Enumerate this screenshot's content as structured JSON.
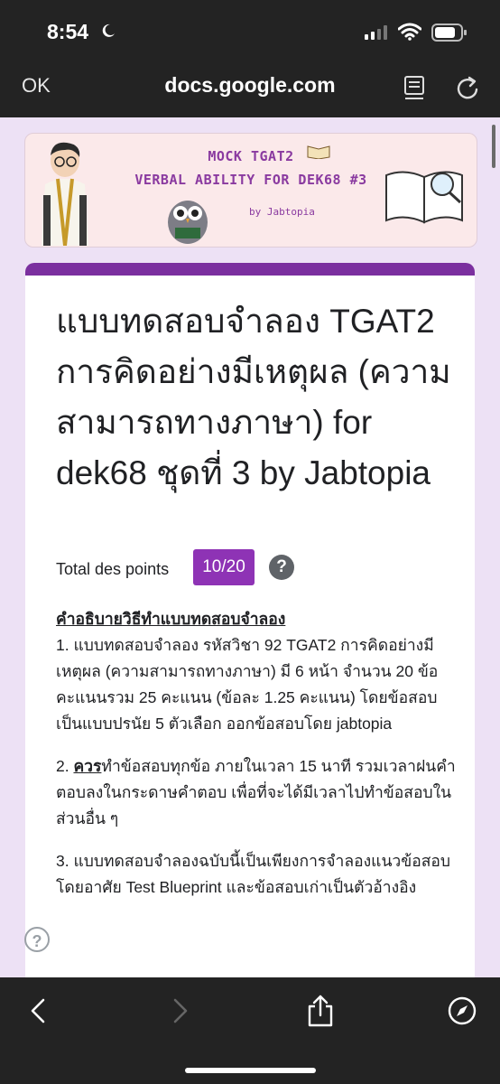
{
  "status": {
    "time": "8:54"
  },
  "browser": {
    "ok_label": "OK",
    "url": "docs.google.com"
  },
  "banner": {
    "line1": "MOCK TGAT2",
    "line2": "VERBAL ABILITY FOR DEK68 #3",
    "by": "by Jabtopia"
  },
  "form": {
    "title": "แบบทดสอบจำลอง TGAT2 การคิดอย่างมีเหตุผล (ความสามารถทางภาษา) for dek68 ชุดที่ 3 by Jabtopia",
    "points_label": "Total des points",
    "score": "10/20",
    "help_symbol": "?",
    "desc_heading": "คำอธิบายวิธีทำแบบทดสอบจำลอง",
    "desc_p1": "1. แบบทดสอบจำลอง รหัสวิชา 92 TGAT2 การคิดอย่างมีเหตุผล (ความสามารถทางภาษา) มี 6 หน้า จำนวน 20 ข้อ คะแนนรวม 25 คะแนน (ข้อละ 1.25 คะแนน) โดยข้อสอบเป็นแบบปรนัย 5 ตัวเลือก ออกข้อสอบโดย jabtopia",
    "desc_p2_prefix": "2. ",
    "desc_p2_strong": "ควร",
    "desc_p2_rest": "ทำข้อสอบทุกข้อ ภายในเวลา 15 นาที รวมเวลาฝนคำตอบลงในกระดาษคำตอบ เพื่อที่จะได้มีเวลาไปทำข้อสอบในส่วนอื่น ๆ",
    "desc_p3": "3. แบบทดสอบจำลองฉบับนี้เป็นเพียงการจำลองแนวข้อสอบ โดยอาศัย Test Blueprint และข้อสอบเก่าเป็นตัวอ้างอิง"
  },
  "floating_help": "?",
  "colors": {
    "accent": "#7b2f9f",
    "score_bg": "#8e33b5",
    "page_bg": "#ede1f5",
    "bar_bg": "#232323"
  }
}
